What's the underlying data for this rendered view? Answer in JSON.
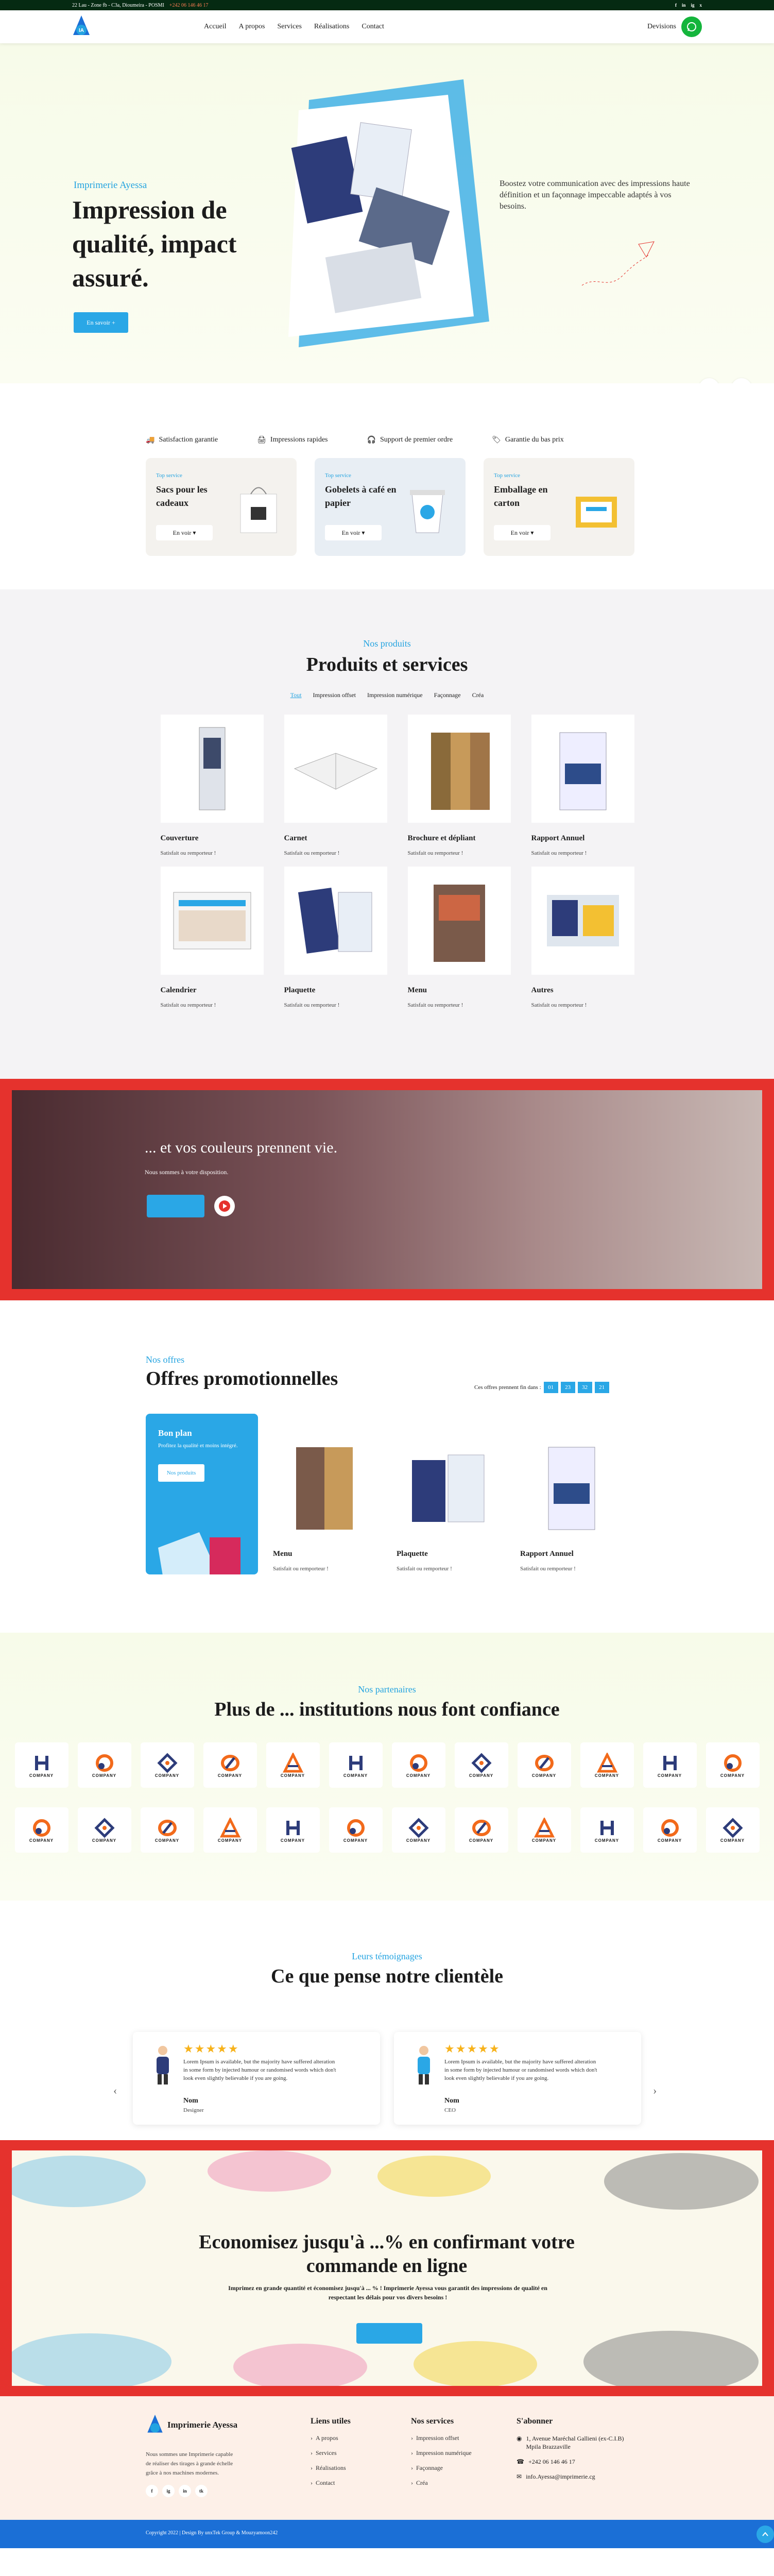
{
  "topbar": {
    "address": "22 Lau - Zone fb - C3a, Dioumeira - POSMI",
    "phone": "+242 06 146 46 17",
    "social": [
      "f",
      "in",
      "ig",
      "x"
    ]
  },
  "header": {
    "nav": [
      "Accueil",
      "A propos",
      "Services",
      "Réalisations",
      "Contact"
    ],
    "quote": "Devisions"
  },
  "hero": {
    "kicker": "Imprimerie Ayessa",
    "title": "Impression de qualité, impact assuré.",
    "cta": "En savoir +",
    "description": "Boostez votre communication avec des impressions haute définition et un façonnage impeccable adaptés à vos besoins.",
    "prev": "←",
    "next": "→"
  },
  "features": [
    "Satisfaction garantie",
    "Impressions rapides",
    "Support de premier ordre",
    "Garantie du bas prix"
  ],
  "services": [
    {
      "tag": "Top service",
      "title": "Sacs pour les cadeaux",
      "button": "En voir ▾"
    },
    {
      "tag": "Top service",
      "title": "Gobelets à café en papier",
      "button": "En voir ▾"
    },
    {
      "tag": "Top service",
      "title": "Emballage en carton",
      "button": "En voir ▾"
    }
  ],
  "products": {
    "kicker": "Nos produits",
    "title": "Produits et services",
    "tabs": [
      "Tout",
      "Impression offset",
      "Impression numérique",
      "Façonnage",
      "Créa"
    ],
    "items": [
      {
        "name": "Couverture",
        "sub": "Satisfait ou remporteur !"
      },
      {
        "name": "Carnet",
        "sub": "Satisfait ou remporteur !"
      },
      {
        "name": "Brochure et dépliant",
        "sub": "Satisfait ou remporteur !"
      },
      {
        "name": "Rapport Annuel",
        "sub": "Satisfait ou remporteur !"
      },
      {
        "name": "Calendrier",
        "sub": "Satisfait ou remporteur !"
      },
      {
        "name": "Plaquette",
        "sub": "Satisfait ou remporteur !"
      },
      {
        "name": "Menu",
        "sub": "Satisfait ou remporteur !"
      },
      {
        "name": "Autres",
        "sub": "Satisfait ou remporteur !"
      }
    ]
  },
  "banner": {
    "title": "... et vos couleurs prennent vie.",
    "subtitle": "Nous sommes à votre disposition."
  },
  "offers": {
    "kicker": "Nos offres",
    "title": "Offres promotionnelles",
    "countdown_label": "Ces offres prennent fin dans :",
    "countdown": [
      "01",
      "23",
      "32",
      "21"
    ],
    "promo": {
      "title": "Bon plan",
      "text": "Profitez la qualité et moins intégré.",
      "button": "Nos produits"
    },
    "items": [
      {
        "name": "Menu",
        "sub": "Satisfait ou remporteur !"
      },
      {
        "name": "Plaquette",
        "sub": "Satisfait ou remporteur !"
      },
      {
        "name": "Rapport Annuel",
        "sub": "Satisfait ou remporteur !"
      }
    ]
  },
  "partners": {
    "kicker": "Nos partenaires",
    "title": "Plus de ... institutions nous font confiance",
    "logo_label": "COMPANY"
  },
  "testimonials": {
    "kicker": "Leurs témoignages",
    "title": "Ce que pense notre clientèle",
    "stars": "★★★★★",
    "items": [
      {
        "quote": "Lorem Ipsum is available, but the majority have suffered alteration in some form by injected humour or randomised words which don't look even slightly believable if you are going.",
        "name": "Nom",
        "role": "Designer"
      },
      {
        "quote": "Lorem Ipsum is available, but the majority have suffered alteration in some form by injected humour or randomised words which don't look even slightly believable if you are going.",
        "name": "Nom",
        "role": "CEO"
      }
    ],
    "prev": "‹",
    "next": "›"
  },
  "cta": {
    "title": "Economisez jusqu'à ...% en confirmant votre commande en ligne",
    "text": "Imprimez en grande quantité et économisez jusqu'à ... % ! Imprimerie Ayessa vous garantit des impressions de qualité en respectant les délais pour vos divers besoins !"
  },
  "footer": {
    "brand": "Imprimerie Ayessa",
    "about": "Nous sommes une Imprimerie capable de réaliser des tirages à grande échelle grâce à nos machines modernes.",
    "socials": [
      "f",
      "ig",
      "in",
      "tk"
    ],
    "links_title": "Liens utiles",
    "links": [
      "A propos",
      "Services",
      "Réalisations",
      "Contact"
    ],
    "services_title": "Nos services",
    "services": [
      "Impression offset",
      "Impression numérique",
      "Façonnage",
      "Créa"
    ],
    "subscribe_title": "S'abonner",
    "address": "1, Avenue Maréchal Gallieni (ex-C.I.B) Mpila Brazzaville",
    "phone": "+242 06 146 46 17",
    "email": "info.Ayessa@imprimerie.cg",
    "copyright": "Copyright 2022 | Design By unxTek Group & Mouzyamoon242"
  }
}
